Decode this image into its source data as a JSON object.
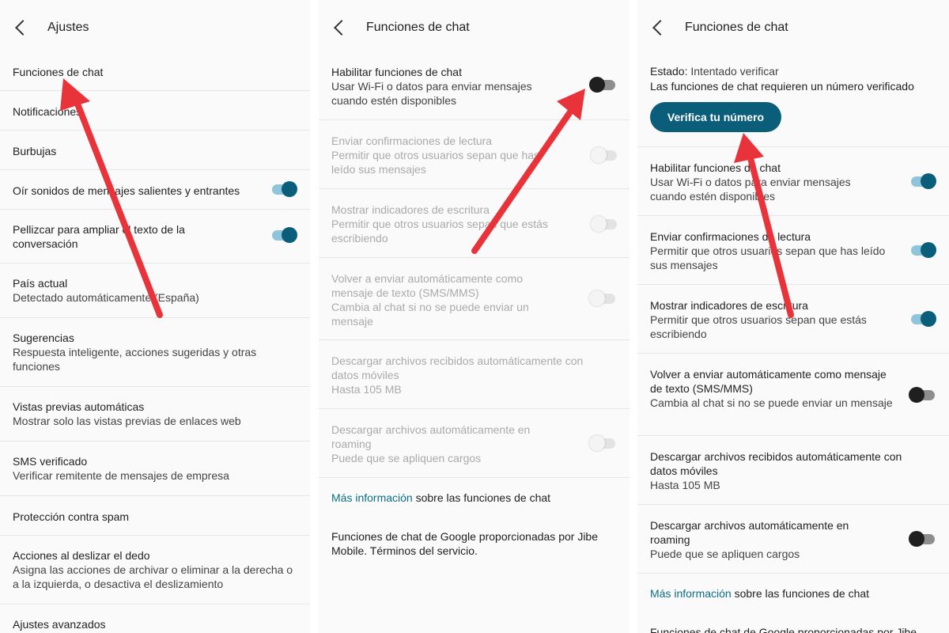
{
  "panel1": {
    "title": "Ajustes",
    "items": [
      {
        "title": "Funciones de chat"
      },
      {
        "title": "Notificaciones"
      },
      {
        "title": "Burbujas"
      },
      {
        "title": "Oír sonidos de mensajes salientes y entrantes",
        "toggle": "on"
      },
      {
        "title": "Pellizcar para ampliar el texto de la conversación",
        "toggle": "on"
      },
      {
        "title": "País actual",
        "subtitle": "Detectado automáticamente (España)"
      },
      {
        "title": "Sugerencias",
        "subtitle": "Respuesta inteligente, acciones sugeridas y otras funciones"
      },
      {
        "title": "Vistas previas automáticas",
        "subtitle": "Mostrar solo las vistas previas de enlaces web"
      },
      {
        "title": "SMS verificado",
        "subtitle": "Verificar remitente de mensajes de empresa"
      },
      {
        "title": "Protección contra spam"
      },
      {
        "title": "Acciones al deslizar el dedo",
        "subtitle": "Asigna las acciones de archivar o eliminar a la derecha o a la izquierda, o desactiva el deslizamiento"
      },
      {
        "title": "Ajustes avanzados"
      }
    ]
  },
  "panel2": {
    "title": "Funciones de chat",
    "items": [
      {
        "title": "Habilitar funciones de chat",
        "subtitle": "Usar Wi-Fi o datos para enviar mensajes cuando estén disponibles",
        "toggle": "off"
      },
      {
        "title": "Enviar confirmaciones de lectura",
        "subtitle": "Permitir que otros usuarios sepan que has leído sus mensajes",
        "toggle": "disabled"
      },
      {
        "title": "Mostrar indicadores de escritura",
        "subtitle": "Permitir que otros usuarios sepan que estás escribiendo",
        "toggle": "disabled"
      },
      {
        "title": "Volver a enviar automáticamente como mensaje de texto (SMS/MMS)",
        "subtitle": "Cambia al chat si no se puede enviar un mensaje",
        "toggle": "disabled"
      },
      {
        "title": "Descargar archivos recibidos automáticamente con datos móviles",
        "subtitle": "Hasta 105 MB"
      },
      {
        "title": "Descargar archivos automáticamente en roaming",
        "subtitle": "Puede que se apliquen cargos",
        "toggle": "disabled"
      }
    ],
    "more_info_link": "Más información",
    "more_info_rest": " sobre las funciones de chat",
    "footer": "Funciones de chat de Google proporcionadas por Jibe Mobile. Términos del servicio."
  },
  "panel3": {
    "title": "Funciones de chat",
    "status_label": "Estado:",
    "status_value": " Intentado verificar",
    "status_note": "Las funciones de chat requieren un número verificado",
    "verify_button": "Verifica tu número",
    "items": [
      {
        "title": "Habilitar funciones de chat",
        "subtitle": "Usar Wi-Fi o datos para enviar mensajes cuando estén disponibles",
        "toggle": "on"
      },
      {
        "title": "Enviar confirmaciones de lectura",
        "subtitle": "Permitir que otros usuarios sepan que has leído sus mensajes",
        "toggle": "on"
      },
      {
        "title": "Mostrar indicadores de escritura",
        "subtitle": "Permitir que otros usuarios sepan que estás escribiendo",
        "toggle": "on"
      },
      {
        "title": "Volver a enviar automáticamente como mensaje de texto (SMS/MMS)",
        "subtitle": "Cambia al chat si no se puede enviar un mensaje",
        "toggle": "off"
      },
      {
        "title": "Descargar archivos recibidos automáticamente con datos móviles",
        "subtitle": "Hasta 105 MB"
      },
      {
        "title": "Descargar archivos automáticamente en roaming",
        "subtitle": "Puede que se apliquen cargos",
        "toggle": "off"
      }
    ],
    "more_info_link": "Más información",
    "more_info_rest": " sobre las funciones de chat",
    "footer": "Funciones de chat de Google proporcionadas por Jibe"
  },
  "colors": {
    "accent": "#0b5e7a",
    "arrow": "#e8333a",
    "link": "#0b6e83"
  }
}
